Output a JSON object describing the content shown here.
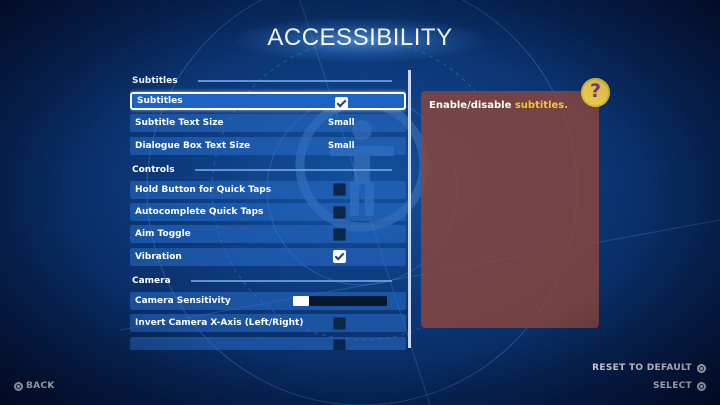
{
  "page": {
    "title": "ACCESSIBILITY"
  },
  "settings": {
    "sections": [
      {
        "label": "Subtitles",
        "items": [
          {
            "label": "Subtitles",
            "control": "checkbox",
            "checked": true,
            "selected": true
          },
          {
            "label": "Subtitle Text Size",
            "control": "value",
            "value": "Small"
          },
          {
            "label": "Dialogue Box Text Size",
            "control": "value",
            "value": "Small"
          }
        ]
      },
      {
        "label": "Controls",
        "items": [
          {
            "label": "Hold Button for Quick Taps",
            "control": "checkbox",
            "checked": false
          },
          {
            "label": "Autocomplete Quick Taps",
            "control": "checkbox",
            "checked": false
          },
          {
            "label": "Aim Toggle",
            "control": "checkbox",
            "checked": false
          },
          {
            "label": "Vibration",
            "control": "checkbox",
            "checked": true
          }
        ]
      },
      {
        "label": "Camera",
        "items": [
          {
            "label": "Camera Sensitivity",
            "control": "slider",
            "level": 0.17
          },
          {
            "label": "Invert Camera X-Axis (Left/Right)",
            "control": "checkbox",
            "checked": false
          },
          {
            "label": "",
            "control": "checkbox",
            "checked": false
          }
        ]
      }
    ]
  },
  "description": {
    "prefix": "Enable/disable ",
    "highlight": "subtitles."
  },
  "help_button": {
    "glyph": "?"
  },
  "footer": {
    "back_label": "BACK",
    "reset_label": "RESET TO DEFAULT",
    "select_label": "SELECT"
  },
  "colors": {
    "highlight": "#f2c830",
    "panel": "#8c463c",
    "help_button": "#f0cf4c"
  }
}
